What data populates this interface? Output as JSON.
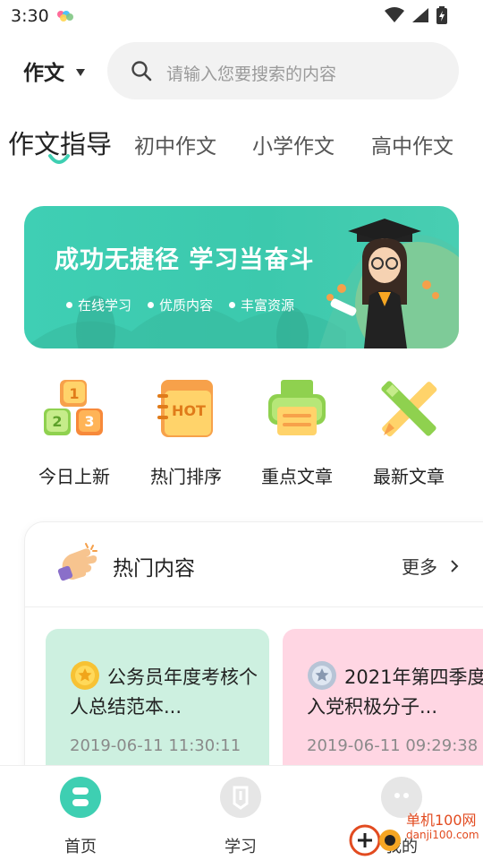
{
  "status": {
    "time": "3:30"
  },
  "header": {
    "category": "作文",
    "search_placeholder": "请输入您要搜索的内容"
  },
  "tabs": [
    {
      "label": "作文指导",
      "active": true
    },
    {
      "label": "初中作文",
      "active": false
    },
    {
      "label": "小学作文",
      "active": false
    },
    {
      "label": "高中作文",
      "active": false
    }
  ],
  "banner": {
    "title": "成功无捷径 学习当奋斗",
    "tags": [
      "在线学习",
      "优质内容",
      "丰富资源"
    ]
  },
  "quick_nav": [
    {
      "label": "今日上新",
      "icon": "number-blocks-icon"
    },
    {
      "label": "热门排序",
      "icon": "hot-notebook-icon"
    },
    {
      "label": "重点文章",
      "icon": "printer-icon"
    },
    {
      "label": "最新文章",
      "icon": "pencil-ruler-icon"
    }
  ],
  "hot_section": {
    "title": "热门内容",
    "more_label": "更多",
    "articles": [
      {
        "title": "公务员年度考核个人总结范本...",
        "date": "2019-06-11 11:30:11",
        "badge": "gold-medal-icon"
      },
      {
        "title": "2021年第四季度入党积极分子...",
        "date": "2019-06-11 09:29:38",
        "badge": "silver-medal-icon"
      }
    ]
  },
  "bottom_nav": [
    {
      "label": "首页",
      "active": true
    },
    {
      "label": "学习",
      "active": false
    },
    {
      "label": "我的",
      "active": false
    }
  ],
  "watermark": {
    "text": "单机100网",
    "sub": "danji100.com"
  },
  "colors": {
    "accent": "#3ecfb2",
    "tab_text": "#555555",
    "date_text": "#8a8a8a"
  }
}
